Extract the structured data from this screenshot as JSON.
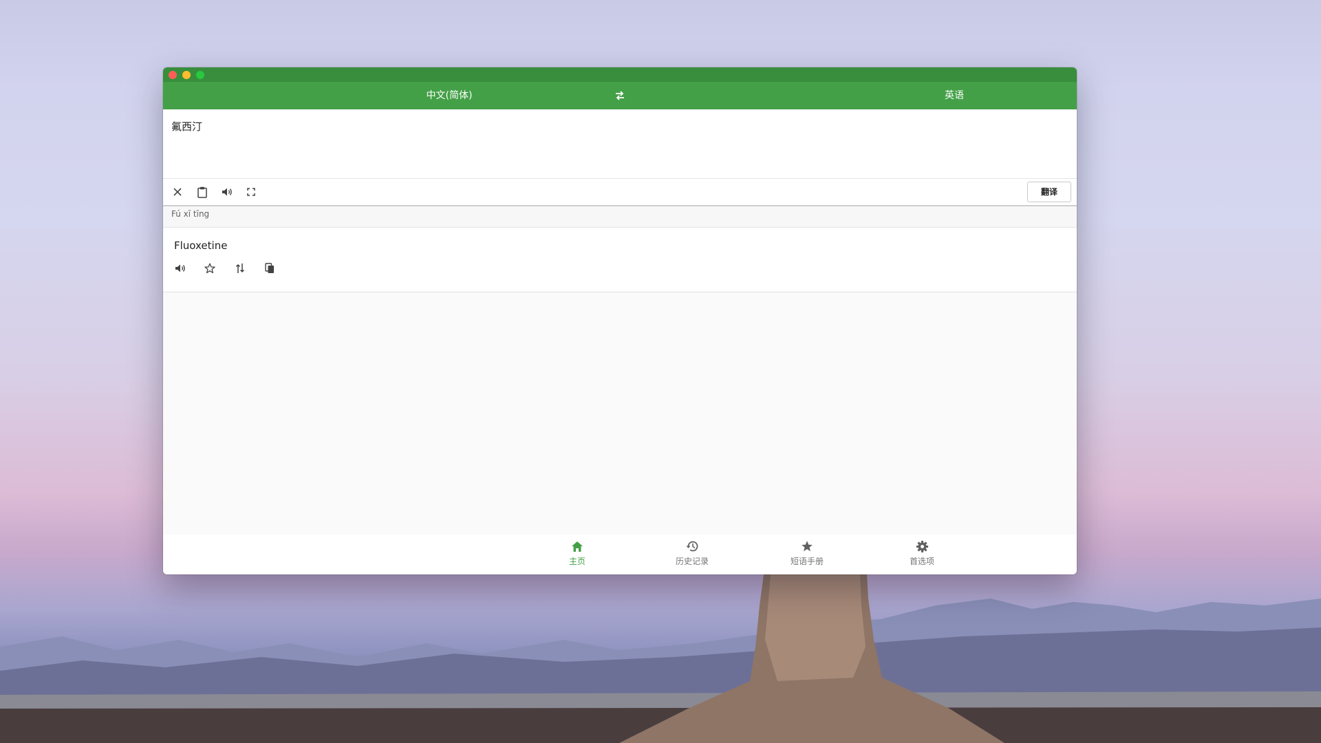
{
  "header": {
    "source_language": "中文(简体)",
    "target_language": "英语",
    "swap_icon": "swap-horizontal-icon"
  },
  "input": {
    "text": "氟西汀"
  },
  "input_toolbar": {
    "icons": [
      "close-icon",
      "clipboard-icon",
      "speaker-icon",
      "fullscreen-icon"
    ],
    "translate_label": "翻译"
  },
  "pinyin": "Fú xī tīng",
  "result": {
    "text": "Fluoxetine",
    "icons": [
      "speaker-icon",
      "star-outline-icon",
      "swap-vertical-icon",
      "copy-icon"
    ]
  },
  "bottom_nav": {
    "items": [
      {
        "label": "主页",
        "icon": "home-icon",
        "active": true
      },
      {
        "label": "历史记录",
        "icon": "history-icon",
        "active": false
      },
      {
        "label": "短语手册",
        "icon": "star-icon",
        "active": false
      },
      {
        "label": "首选项",
        "icon": "gear-icon",
        "active": false
      }
    ]
  },
  "colors": {
    "titlebar": "#388e3c",
    "primary": "#43a047",
    "active_nav": "#43a047"
  }
}
